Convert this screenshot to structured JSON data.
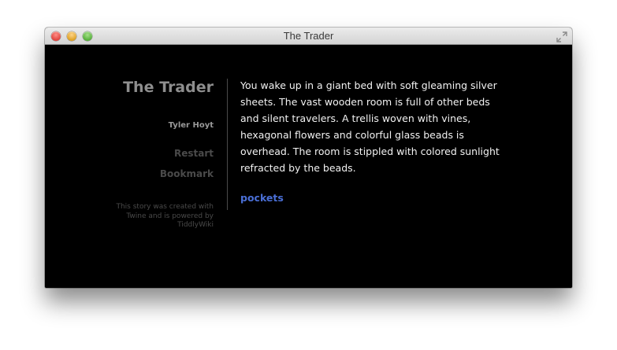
{
  "window": {
    "title": "The Trader"
  },
  "sidebar": {
    "story_title": "The Trader",
    "author": "Tyler Hoyt",
    "menu": {
      "restart": "Restart",
      "bookmark": "Bookmark"
    },
    "credits": "This story was created with Twine and is powered by TiddlyWiki"
  },
  "passage": {
    "text": "You wake up in a giant bed with soft gleaming silver sheets. The vast wooden room is full of other beds and silent travelers. A trellis woven with vines, hexagonal flowers and colorful glass beads is overhead. The room is stippled with colored sunlight refracted by the beads.",
    "link": "pockets"
  },
  "colors": {
    "background": "#000000",
    "passage_text": "#f2f2f2",
    "link": "#4a6fd6",
    "sidebar_title": "#8e8e8e",
    "sidebar_muted": "#4a4a4a"
  }
}
